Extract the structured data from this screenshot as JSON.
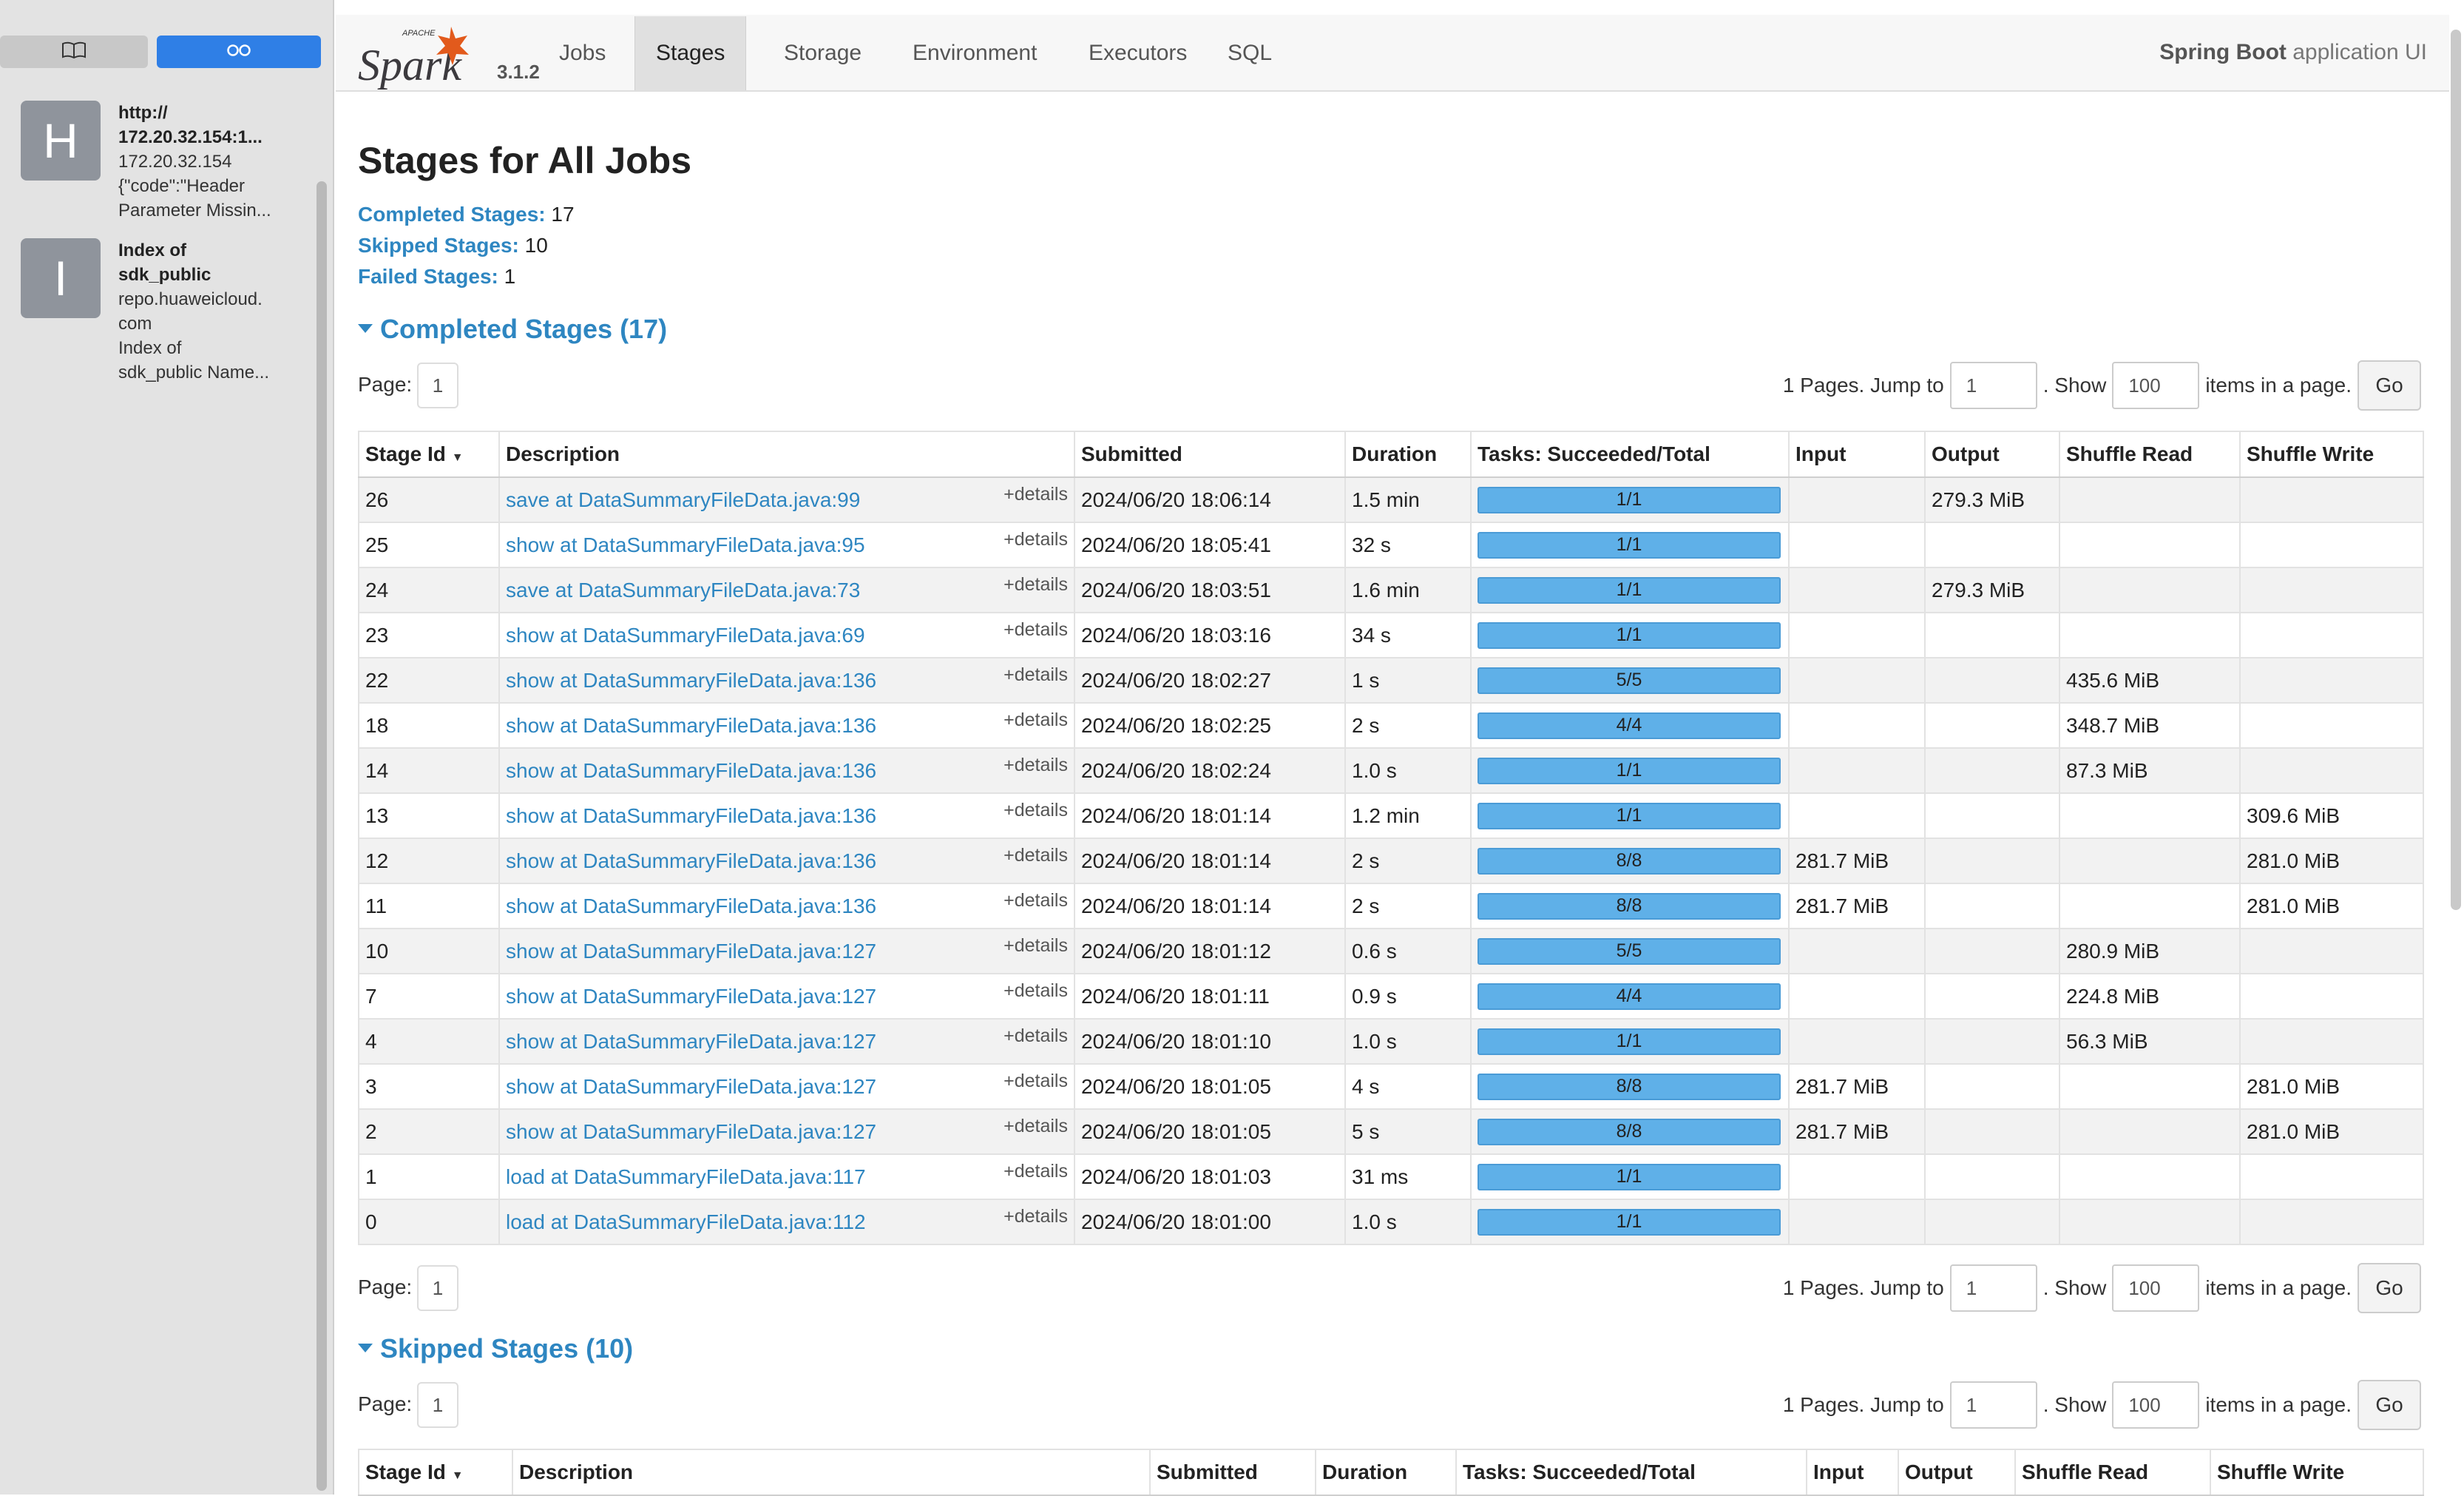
{
  "sidebar": {
    "tabs": [
      {
        "icon": "book-icon"
      },
      {
        "icon": "reading-list-icon"
      }
    ],
    "entries": [
      {
        "letter": "H",
        "title_lines": [
          "http://",
          "172.20.32.154:1..."
        ],
        "lines": [
          "172.20.32.154",
          "{\"code\":\"Header",
          "Parameter Missin..."
        ]
      },
      {
        "letter": "I",
        "title_lines": [
          "Index of",
          "sdk_public"
        ],
        "lines": [
          "repo.huaweicloud.",
          "com",
          "Index of",
          "sdk_public Name..."
        ]
      }
    ]
  },
  "header": {
    "logo_small": "APACHE",
    "logo_text": "Spark",
    "version": "3.1.2",
    "tabs": [
      "Jobs",
      "Stages",
      "Storage",
      "Environment",
      "Executors",
      "SQL"
    ],
    "active_tab": "Stages",
    "app_title_bold": "Spring Boot",
    "app_title_rest": " application UI"
  },
  "page": {
    "title": "Stages for All Jobs",
    "summary": [
      {
        "label": "Completed Stages:",
        "value": "17"
      },
      {
        "label": "Skipped Stages:",
        "value": "10"
      },
      {
        "label": "Failed Stages:",
        "value": "1"
      }
    ]
  },
  "pager": {
    "page_label": "Page:",
    "page_value": "1",
    "pages_text": "1 Pages. Jump to",
    "jump_value": "1",
    "show_text": ". Show",
    "show_value": "100",
    "items_text": "items in a page.",
    "go_label": "Go"
  },
  "completed": {
    "title": "Completed Stages (17)",
    "columns": [
      "Stage Id",
      "Description",
      "Submitted",
      "Duration",
      "Tasks: Succeeded/Total",
      "Input",
      "Output",
      "Shuffle Read",
      "Shuffle Write"
    ],
    "sort_indicator": "▼",
    "details_label": "+details",
    "rows": [
      {
        "id": "26",
        "desc": "save at DataSummaryFileData.java:99",
        "submitted": "2024/06/20 18:06:14",
        "duration": "1.5 min",
        "tasks": "1/1",
        "input": "",
        "output": "279.3 MiB",
        "shuffle_read": "",
        "shuffle_write": ""
      },
      {
        "id": "25",
        "desc": "show at DataSummaryFileData.java:95",
        "submitted": "2024/06/20 18:05:41",
        "duration": "32 s",
        "tasks": "1/1",
        "input": "",
        "output": "",
        "shuffle_read": "",
        "shuffle_write": ""
      },
      {
        "id": "24",
        "desc": "save at DataSummaryFileData.java:73",
        "submitted": "2024/06/20 18:03:51",
        "duration": "1.6 min",
        "tasks": "1/1",
        "input": "",
        "output": "279.3 MiB",
        "shuffle_read": "",
        "shuffle_write": ""
      },
      {
        "id": "23",
        "desc": "show at DataSummaryFileData.java:69",
        "submitted": "2024/06/20 18:03:16",
        "duration": "34 s",
        "tasks": "1/1",
        "input": "",
        "output": "",
        "shuffle_read": "",
        "shuffle_write": ""
      },
      {
        "id": "22",
        "desc": "show at DataSummaryFileData.java:136",
        "submitted": "2024/06/20 18:02:27",
        "duration": "1 s",
        "tasks": "5/5",
        "input": "",
        "output": "",
        "shuffle_read": "435.6 MiB",
        "shuffle_write": ""
      },
      {
        "id": "18",
        "desc": "show at DataSummaryFileData.java:136",
        "submitted": "2024/06/20 18:02:25",
        "duration": "2 s",
        "tasks": "4/4",
        "input": "",
        "output": "",
        "shuffle_read": "348.7 MiB",
        "shuffle_write": ""
      },
      {
        "id": "14",
        "desc": "show at DataSummaryFileData.java:136",
        "submitted": "2024/06/20 18:02:24",
        "duration": "1.0 s",
        "tasks": "1/1",
        "input": "",
        "output": "",
        "shuffle_read": "87.3 MiB",
        "shuffle_write": ""
      },
      {
        "id": "13",
        "desc": "show at DataSummaryFileData.java:136",
        "submitted": "2024/06/20 18:01:14",
        "duration": "1.2 min",
        "tasks": "1/1",
        "input": "",
        "output": "",
        "shuffle_read": "",
        "shuffle_write": "309.6 MiB"
      },
      {
        "id": "12",
        "desc": "show at DataSummaryFileData.java:136",
        "submitted": "2024/06/20 18:01:14",
        "duration": "2 s",
        "tasks": "8/8",
        "input": "281.7 MiB",
        "output": "",
        "shuffle_read": "",
        "shuffle_write": "281.0 MiB"
      },
      {
        "id": "11",
        "desc": "show at DataSummaryFileData.java:136",
        "submitted": "2024/06/20 18:01:14",
        "duration": "2 s",
        "tasks": "8/8",
        "input": "281.7 MiB",
        "output": "",
        "shuffle_read": "",
        "shuffle_write": "281.0 MiB"
      },
      {
        "id": "10",
        "desc": "show at DataSummaryFileData.java:127",
        "submitted": "2024/06/20 18:01:12",
        "duration": "0.6 s",
        "tasks": "5/5",
        "input": "",
        "output": "",
        "shuffle_read": "280.9 MiB",
        "shuffle_write": ""
      },
      {
        "id": "7",
        "desc": "show at DataSummaryFileData.java:127",
        "submitted": "2024/06/20 18:01:11",
        "duration": "0.9 s",
        "tasks": "4/4",
        "input": "",
        "output": "",
        "shuffle_read": "224.8 MiB",
        "shuffle_write": ""
      },
      {
        "id": "4",
        "desc": "show at DataSummaryFileData.java:127",
        "submitted": "2024/06/20 18:01:10",
        "duration": "1.0 s",
        "tasks": "1/1",
        "input": "",
        "output": "",
        "shuffle_read": "56.3 MiB",
        "shuffle_write": ""
      },
      {
        "id": "3",
        "desc": "show at DataSummaryFileData.java:127",
        "submitted": "2024/06/20 18:01:05",
        "duration": "4 s",
        "tasks": "8/8",
        "input": "281.7 MiB",
        "output": "",
        "shuffle_read": "",
        "shuffle_write": "281.0 MiB"
      },
      {
        "id": "2",
        "desc": "show at DataSummaryFileData.java:127",
        "submitted": "2024/06/20 18:01:05",
        "duration": "5 s",
        "tasks": "8/8",
        "input": "281.7 MiB",
        "output": "",
        "shuffle_read": "",
        "shuffle_write": "281.0 MiB"
      },
      {
        "id": "1",
        "desc": "load at DataSummaryFileData.java:117",
        "submitted": "2024/06/20 18:01:03",
        "duration": "31 ms",
        "tasks": "1/1",
        "input": "",
        "output": "",
        "shuffle_read": "",
        "shuffle_write": ""
      },
      {
        "id": "0",
        "desc": "load at DataSummaryFileData.java:112",
        "submitted": "2024/06/20 18:01:00",
        "duration": "1.0 s",
        "tasks": "1/1",
        "input": "",
        "output": "",
        "shuffle_read": "",
        "shuffle_write": ""
      }
    ]
  },
  "skipped": {
    "title": "Skipped Stages (10)",
    "columns": [
      "Stage Id",
      "Description",
      "Submitted",
      "Duration",
      "Tasks: Succeeded/Total",
      "Input",
      "Output",
      "Shuffle Read",
      "Shuffle Write"
    ]
  },
  "colors": {
    "link": "#2e86c1",
    "progress": "#5fb0e8",
    "sidebar_active": "#2f7fe6"
  }
}
